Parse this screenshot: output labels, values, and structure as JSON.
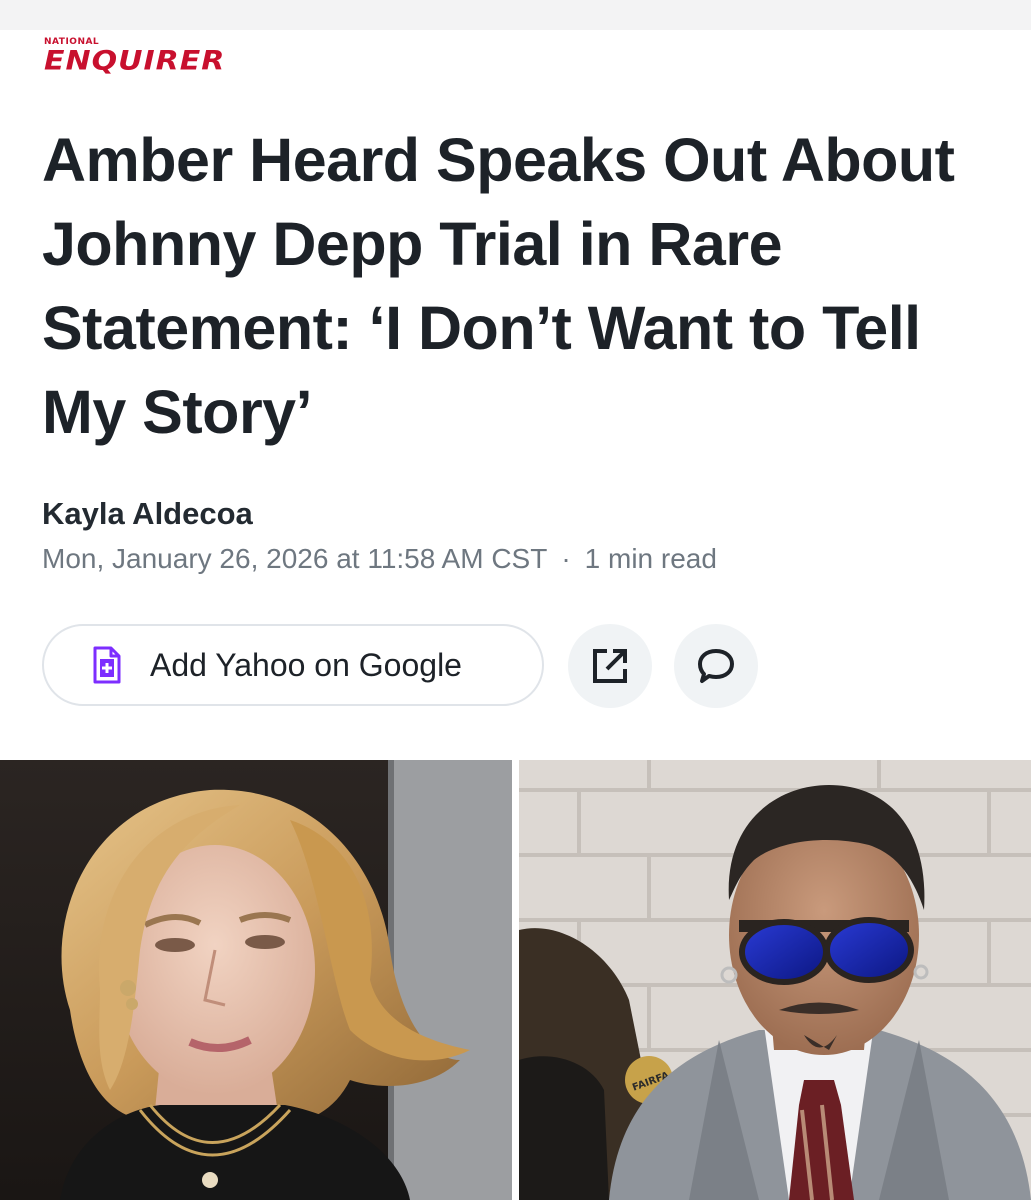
{
  "logo": {
    "top_text": "NATIONAL",
    "main_text": "ENQUIRER"
  },
  "article": {
    "headline": "Amber Heard Speaks Out About Johnny Depp Trial in Rare Statement: ‘I Don’t Want to Tell My Story’",
    "author": "Kayla Aldecoa",
    "date": "Mon, January 26, 2026 at 11:58 AM CST",
    "separator": "·",
    "read_time": "1 min read"
  },
  "actions": {
    "google_button_label": "Add Yahoo on Google",
    "google_icon": "doc-plus-icon",
    "share_icon": "external-link-icon",
    "comment_icon": "comment-icon"
  },
  "photos": {
    "left_badge_text": "FAIRFA"
  },
  "colors": {
    "brand_red": "#c8102e",
    "accent_purple": "#7d2eff",
    "text_primary": "#1d2228",
    "text_secondary": "#6e7780"
  }
}
